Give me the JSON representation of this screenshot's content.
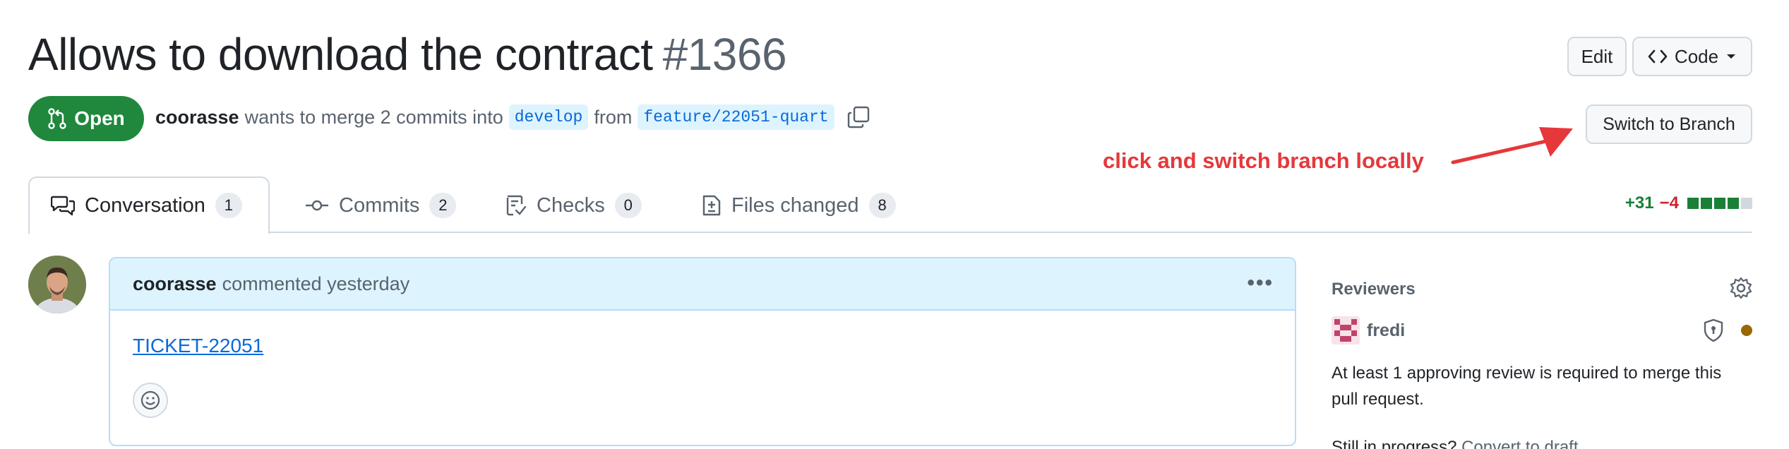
{
  "pr": {
    "title": "Allows to download the contract",
    "number": "#1366",
    "state": "Open",
    "author": "coorasse",
    "merge_text": "wants to merge 2 commits into",
    "base_branch": "develop",
    "from_text": "from",
    "head_branch": "feature/22051-quart"
  },
  "header": {
    "edit_label": "Edit",
    "code_label": "Code",
    "switch_label": "Switch to Branch"
  },
  "annotation": {
    "text": "click and switch branch locally",
    "color": "#e5383b"
  },
  "tabs": [
    {
      "label": "Conversation",
      "count": "1",
      "icon": "comment-discussion-icon"
    },
    {
      "label": "Commits",
      "count": "2",
      "icon": "git-commit-icon"
    },
    {
      "label": "Checks",
      "count": "0",
      "icon": "checklist-icon"
    },
    {
      "label": "Files changed",
      "count": "8",
      "icon": "file-diff-icon"
    }
  ],
  "diffstat": {
    "additions": "+31",
    "deletions": "−4",
    "blocks": [
      "added",
      "added",
      "added",
      "added",
      "neutral"
    ]
  },
  "comment": {
    "author": "coorasse",
    "action": "commented yesterday",
    "body_link": "TICKET-22051"
  },
  "sidebar": {
    "reviewers_title": "Reviewers",
    "reviewer_name": "fredi",
    "rule_text": "At least 1 approving review is required to merge this pull request.",
    "progress_text": "Still in progress?",
    "progress_link": "Convert to draft"
  },
  "colors": {
    "open_green": "#1f883d",
    "link_blue": "#0969da",
    "added_green": "#1a7f37",
    "deleted_red": "#cf222e",
    "pending_dot": "#9a6700"
  }
}
